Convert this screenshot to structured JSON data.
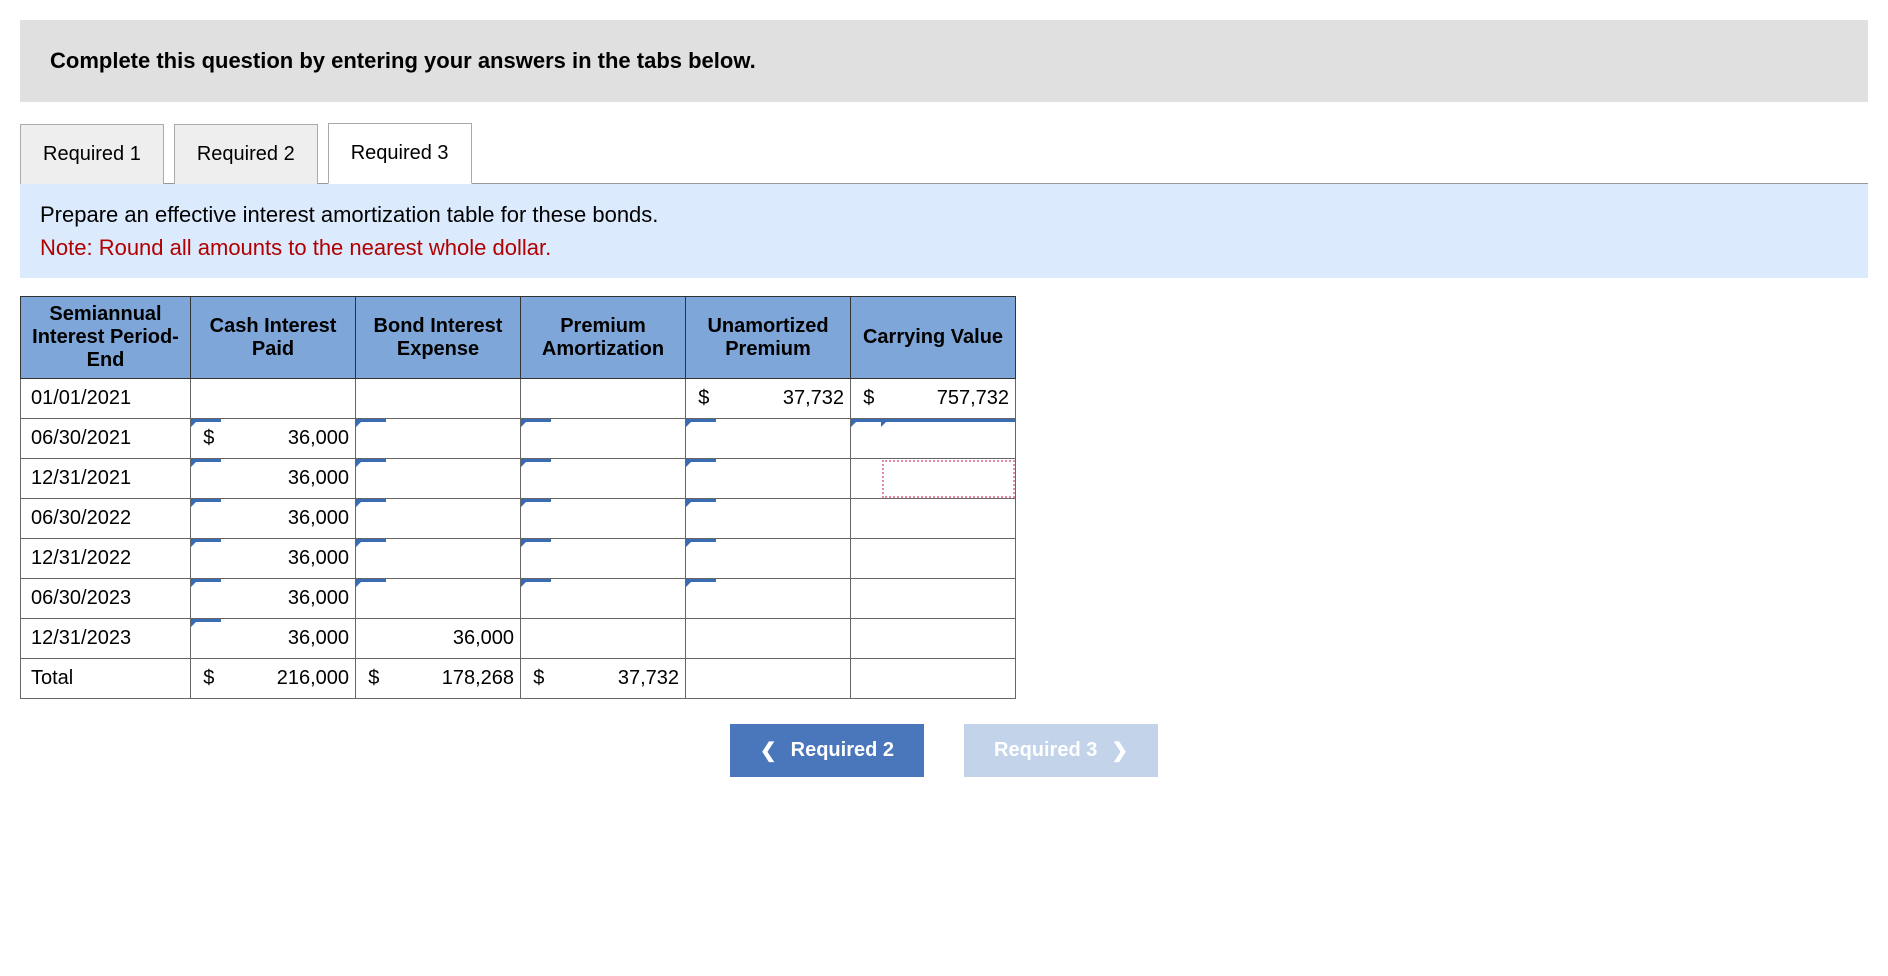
{
  "banner": "Complete this question by entering your answers in the tabs below.",
  "tabs": [
    "Required 1",
    "Required 2",
    "Required 3"
  ],
  "activeTab": 2,
  "prompt": {
    "main": "Prepare an effective interest amortization table for these bonds.",
    "note": "Note: Round all amounts to the nearest whole dollar."
  },
  "headers": {
    "period": "Semiannual Interest Period-End",
    "cash": "Cash Interest Paid",
    "expense": "Bond Interest Expense",
    "amort": "Premium Amortization",
    "unamort": "Unamortized Premium",
    "carry": "Carrying Value"
  },
  "rows": [
    {
      "period": "01/01/2021",
      "cash_sym": "",
      "cash_val": "",
      "exp_sym": "",
      "exp_val": "",
      "am_sym": "",
      "am_val": "",
      "un_sym": "$",
      "un_val": "37,732",
      "car_sym": "$",
      "car_val": "757,732",
      "cash_editable": false,
      "exp_editable": false,
      "am_editable": false,
      "un_editable": false,
      "car_editable": false
    },
    {
      "period": "06/30/2021",
      "cash_sym": "$",
      "cash_val": "36,000",
      "exp_sym": "",
      "exp_val": "",
      "am_sym": "",
      "am_val": "",
      "un_sym": "",
      "un_val": "",
      "car_sym": "",
      "car_val": "",
      "cash_editable": true,
      "exp_editable": true,
      "am_editable": true,
      "un_editable": true,
      "car_editable": true,
      "car_focus": true
    },
    {
      "period": "12/31/2021",
      "cash_sym": "",
      "cash_val": "36,000",
      "exp_sym": "",
      "exp_val": "",
      "am_sym": "",
      "am_val": "",
      "un_sym": "",
      "un_val": "",
      "car_sym": "",
      "car_val": "",
      "cash_editable": true,
      "exp_editable": true,
      "am_editable": true,
      "un_editable": true,
      "car_editable": false,
      "car_dotted": true
    },
    {
      "period": "06/30/2022",
      "cash_sym": "",
      "cash_val": "36,000",
      "exp_sym": "",
      "exp_val": "",
      "am_sym": "",
      "am_val": "",
      "un_sym": "",
      "un_val": "",
      "car_sym": "",
      "car_val": "",
      "cash_editable": true,
      "exp_editable": true,
      "am_editable": true,
      "un_editable": true,
      "car_editable": false
    },
    {
      "period": "12/31/2022",
      "cash_sym": "",
      "cash_val": "36,000",
      "exp_sym": "",
      "exp_val": "",
      "am_sym": "",
      "am_val": "",
      "un_sym": "",
      "un_val": "",
      "car_sym": "",
      "car_val": "",
      "cash_editable": true,
      "exp_editable": true,
      "am_editable": true,
      "un_editable": true,
      "car_editable": false
    },
    {
      "period": "06/30/2023",
      "cash_sym": "",
      "cash_val": "36,000",
      "exp_sym": "",
      "exp_val": "",
      "am_sym": "",
      "am_val": "",
      "un_sym": "",
      "un_val": "",
      "car_sym": "",
      "car_val": "",
      "cash_editable": true,
      "exp_editable": true,
      "am_editable": true,
      "un_editable": true,
      "car_editable": false
    },
    {
      "period": "12/31/2023",
      "cash_sym": "",
      "cash_val": "36,000",
      "exp_sym": "",
      "exp_val": "36,000",
      "am_sym": "",
      "am_val": "",
      "un_sym": "",
      "un_val": "",
      "car_sym": "",
      "car_val": "",
      "cash_editable": true,
      "exp_editable": false,
      "am_editable": false,
      "un_editable": false,
      "car_editable": false
    },
    {
      "period": "Total",
      "cash_sym": "$",
      "cash_val": "216,000",
      "exp_sym": "$",
      "exp_val": "178,268",
      "am_sym": "$",
      "am_val": "37,732",
      "un_sym": "",
      "un_val": "",
      "car_sym": "",
      "car_val": "",
      "cash_editable": false,
      "exp_editable": false,
      "am_editable": false,
      "un_editable": false,
      "car_editable": false
    }
  ],
  "nav": {
    "prev": "Required 2",
    "next": "Required 3"
  }
}
